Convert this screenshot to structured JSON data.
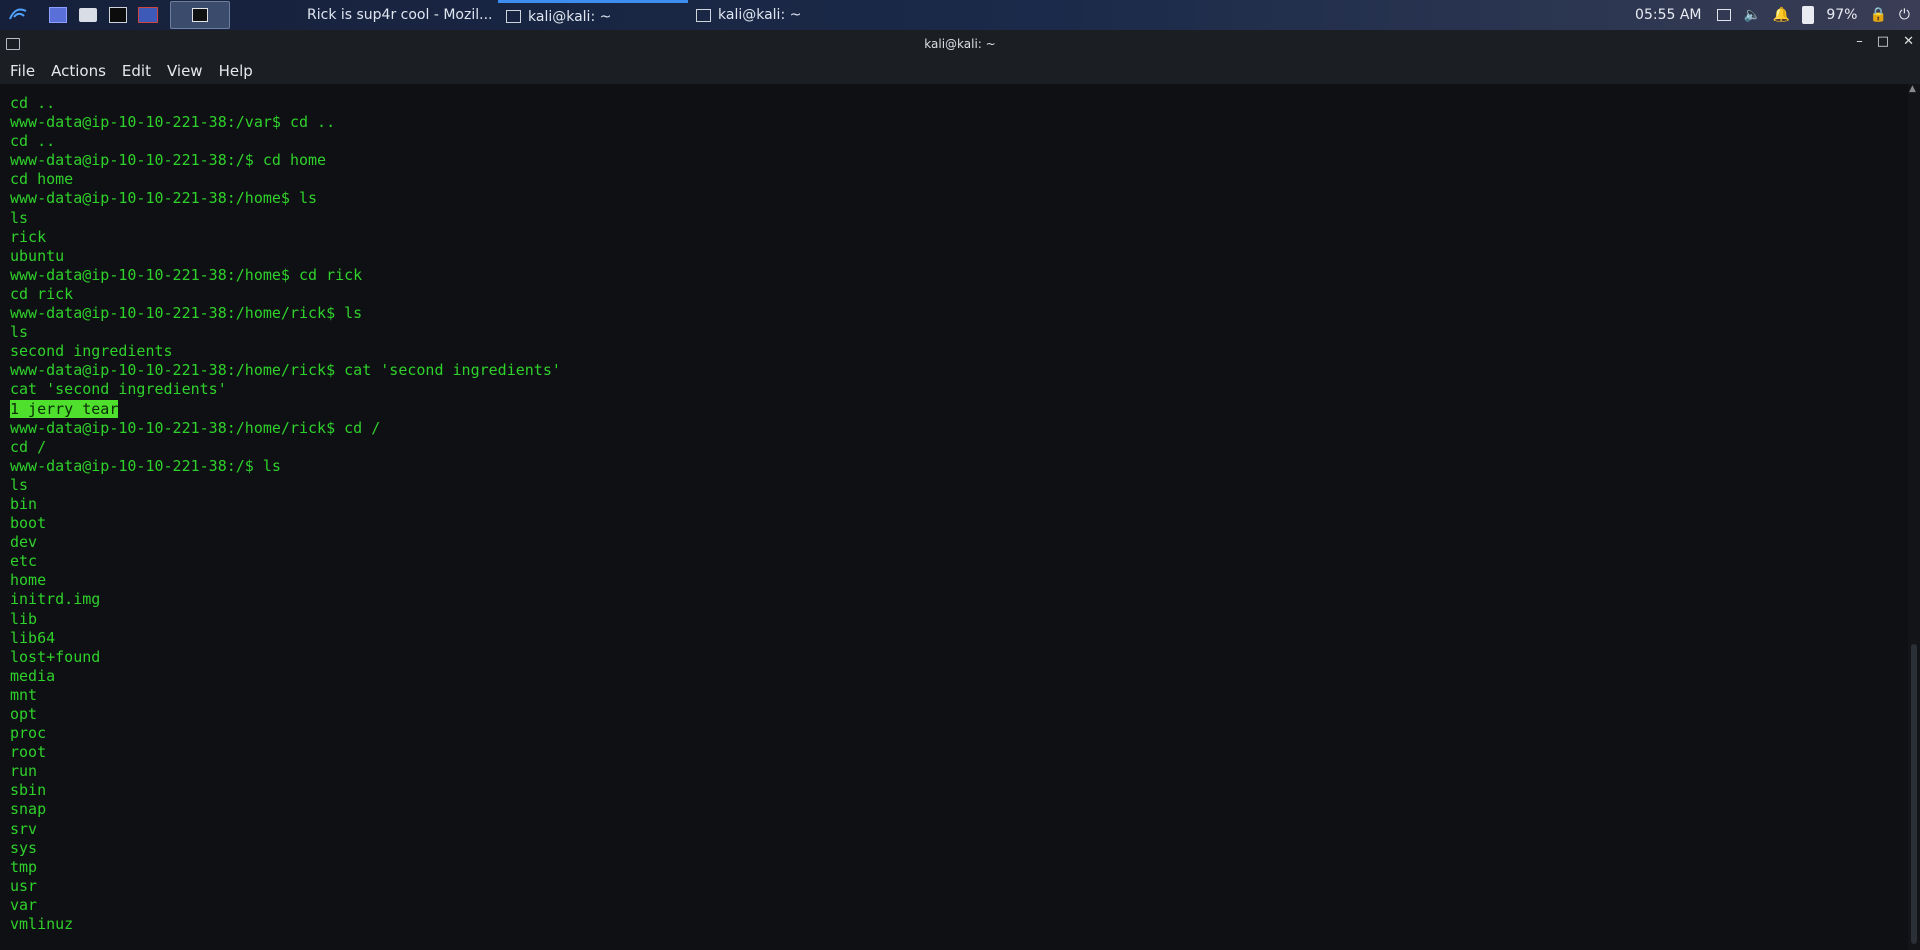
{
  "panel": {
    "tasks": [
      {
        "label": "Rick is sup4r cool - Mozil..."
      },
      {
        "label": "kali@kali: ~"
      },
      {
        "label": "kali@kali: ~"
      }
    ],
    "clock": "05:55 AM",
    "battery": "97%"
  },
  "window": {
    "title": "kali@kali: ~"
  },
  "menu": {
    "file": "File",
    "actions": "Actions",
    "edit": "Edit",
    "view": "View",
    "help": "Help"
  },
  "terminal": {
    "lines": [
      "cd ..",
      "www-data@ip-10-10-221-38:/var$ cd ..",
      "cd ..",
      "www-data@ip-10-10-221-38:/$ cd home",
      "cd home",
      "www-data@ip-10-10-221-38:/home$ ls",
      "ls",
      "rick",
      "ubuntu",
      "www-data@ip-10-10-221-38:/home$ cd rick",
      "cd rick",
      "www-data@ip-10-10-221-38:/home/rick$ ls",
      "ls",
      "second ingredients",
      "www-data@ip-10-10-221-38:/home/rick$ cat 'second ingredients'",
      "cat 'second ingredients'",
      "1 jerry tear",
      "www-data@ip-10-10-221-38:/home/rick$ cd /",
      "cd /",
      "www-data@ip-10-10-221-38:/$ ls",
      "ls",
      "bin",
      "boot",
      "dev",
      "etc",
      "home",
      "initrd.img",
      "lib",
      "lib64",
      "lost+found",
      "media",
      "mnt",
      "opt",
      "proc",
      "root",
      "run",
      "sbin",
      "snap",
      "srv",
      "sys",
      "tmp",
      "usr",
      "var",
      "vmlinuz"
    ],
    "highlight_index": 16
  },
  "colors": {
    "terminal_text": "#2fd12b",
    "highlight_bg": "#4ee02c"
  }
}
